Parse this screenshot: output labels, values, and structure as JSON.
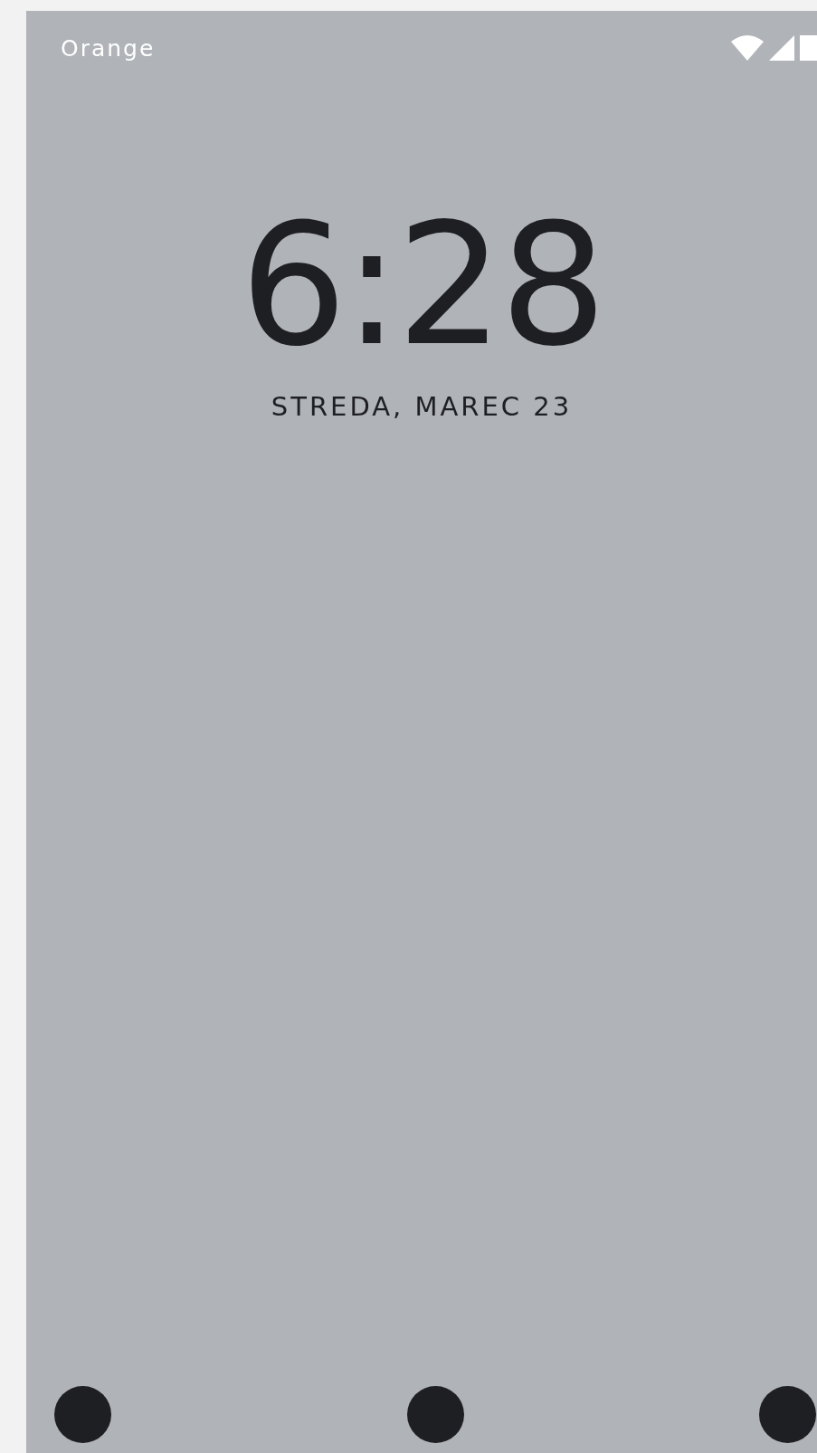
{
  "status_bar": {
    "carrier": "Orange"
  },
  "clock": {
    "time": "6:28",
    "date": "STREDA, MAREC 23"
  }
}
